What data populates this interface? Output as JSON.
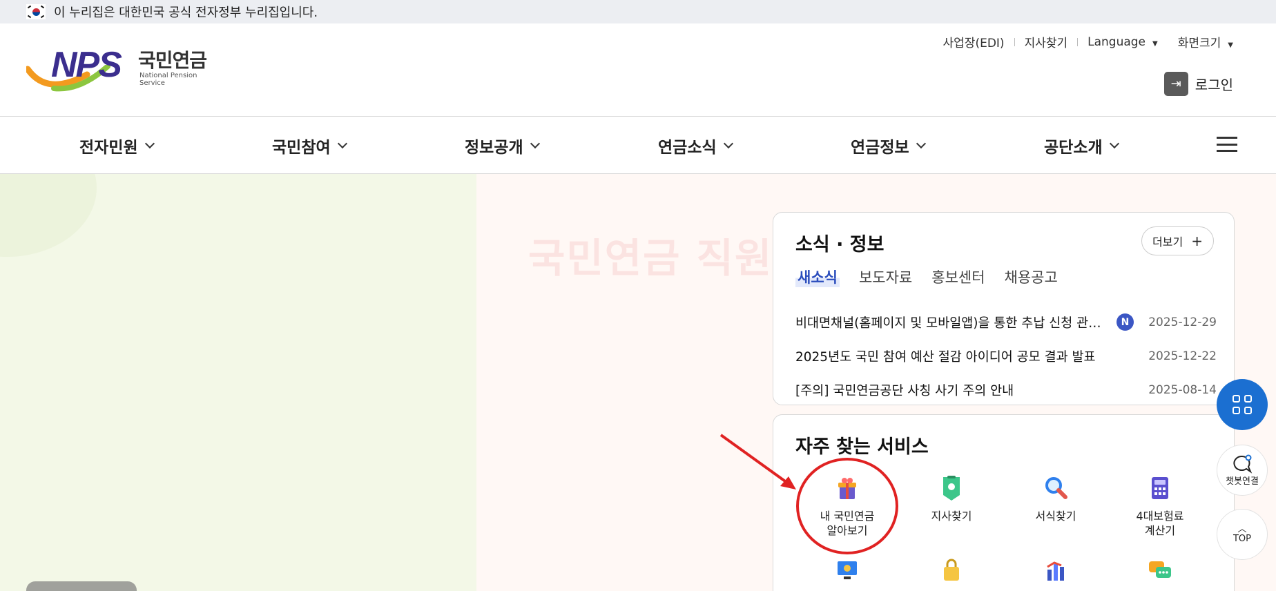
{
  "gov_banner": {
    "text": "이 누리집은 대한민국 공식 전자정부 누리집입니다."
  },
  "logo": {
    "mark": "NPS",
    "name_ko": "국민연금",
    "name_en": "National Pension Service"
  },
  "util_links": [
    {
      "label": "사업장(EDI)"
    },
    {
      "label": "지사찾기"
    },
    {
      "label": "Language"
    },
    {
      "label": "화면크기"
    }
  ],
  "login": {
    "label": "로그인"
  },
  "nav": [
    {
      "label": "전자민원"
    },
    {
      "label": "국민참여"
    },
    {
      "label": "정보공개"
    },
    {
      "label": "연금소식"
    },
    {
      "label": "연금정보"
    },
    {
      "label": "공단소개"
    }
  ],
  "hero": {
    "watermark": "국민연금 직원"
  },
  "news": {
    "title": "소식 · 정보",
    "more_label": "더보기",
    "tabs": [
      "새소식",
      "보도자료",
      "홍보센터",
      "채용공고"
    ],
    "items": [
      {
        "title": "비대면채널(홈페이지 및 모바일앱)을 통한 추납 신청 관련 안내",
        "badge": "N",
        "date": "2025-12-29"
      },
      {
        "title": "2025년도 국민 참여 예산 절감 아이디어 공모 결과 발표",
        "badge": "",
        "date": "2025-12-22"
      },
      {
        "title": "[주의] 국민연금공단 사칭 사기 주의 안내",
        "badge": "",
        "date": "2025-08-14"
      }
    ]
  },
  "services": {
    "title": "자주 찾는 서비스",
    "items": [
      {
        "label1": "내 국민연금",
        "label2": "알아보기",
        "icon": "gift-icon"
      },
      {
        "label1": "지사찾기",
        "label2": "",
        "icon": "map-pin-icon"
      },
      {
        "label1": "서식찾기",
        "label2": "",
        "icon": "magnifier-icon"
      },
      {
        "label1": "4대보험료",
        "label2": "계산기",
        "icon": "calculator-icon"
      }
    ]
  },
  "floating": {
    "chatbot": "챗봇연결",
    "top": "TOP"
  },
  "colors": {
    "accent": "#1b6fd1",
    "brand": "#3b2e8e",
    "annotation": "#e02222"
  }
}
